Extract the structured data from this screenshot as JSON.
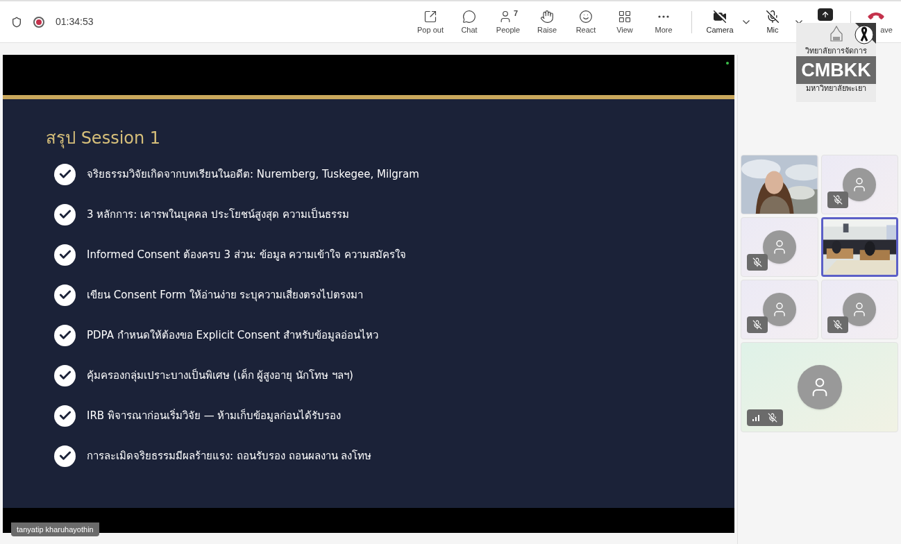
{
  "call_bar": {
    "timer": "01:34:53",
    "recording": true,
    "controls": [
      {
        "kind": "popout",
        "label": "Pop out"
      },
      {
        "kind": "chat",
        "label": "Chat"
      },
      {
        "kind": "people",
        "label": "People",
        "count": "7"
      },
      {
        "kind": "raise",
        "label": "Raise"
      },
      {
        "kind": "react",
        "label": "React"
      },
      {
        "kind": "view",
        "label": "View"
      },
      {
        "kind": "more",
        "label": "More"
      }
    ],
    "devices": [
      {
        "kind": "camera",
        "label": "Camera",
        "off": true
      },
      {
        "kind": "mic",
        "label": "Mic",
        "off": true
      }
    ],
    "leave": {
      "label": "ave"
    }
  },
  "logo_overlay": {
    "top_text": "วิทยาลัยการจัดการ",
    "mark": "CMBKK",
    "bottom_text": "มหาวิทยาลัยพะเยา"
  },
  "slide": {
    "title": "สรุป Session 1",
    "items": [
      {
        "text": "จริยธรรมวิจัยเกิดจากบทเรียนในอดีต: Nuremberg, Tuskegee, Milgram",
        "checked": true
      },
      {
        "text": "3 หลักการ: เคารพในบุคคล ประโยชน์สูงสุด ความเป็นธรรม",
        "checked": true
      },
      {
        "text": "Informed Consent ต้องครบ 3 ส่วน: ข้อมูล ความเข้าใจ ความสมัครใจ",
        "checked": true
      },
      {
        "text": "เขียน Consent Form ให้อ่านง่าย ระบุความเสี่ยงตรงไปตรงมา",
        "checked": true
      },
      {
        "text": "PDPA กำหนดให้ต้องขอ Explicit Consent สำหรับข้อมูลอ่อนไหว",
        "checked": true
      },
      {
        "text": "คุ้มครองกลุ่มเปราะบางเป็นพิเศษ (เด็ก ผู้สูงอายุ นักโทษ ฯลฯ)",
        "checked": true
      },
      {
        "text": "IRB พิจารณาก่อนเริ่มวิจัย — ห้ามเก็บข้อมูลก่อนได้รับรอง",
        "checked": true
      },
      {
        "text": "การละเมิดจริยธรรมมีผลร้ายแรง: ถอนรับรอง ถอนผลงาน ลงโทษ",
        "checked": true
      }
    ]
  },
  "presenter": {
    "name": "tanyatip kharuhayothin"
  },
  "tiles": [
    {
      "kind": "video",
      "muted": false,
      "selected": false
    },
    {
      "kind": "avatar",
      "muted": true,
      "selected": false
    },
    {
      "kind": "avatar",
      "muted": true,
      "selected": false
    },
    {
      "kind": "video",
      "muted": false,
      "selected": true
    },
    {
      "kind": "avatar",
      "muted": true,
      "selected": false
    },
    {
      "kind": "avatar",
      "muted": true,
      "selected": false
    },
    {
      "kind": "avatar",
      "muted": true,
      "selected": false,
      "wide": true,
      "signal": true
    }
  ]
}
